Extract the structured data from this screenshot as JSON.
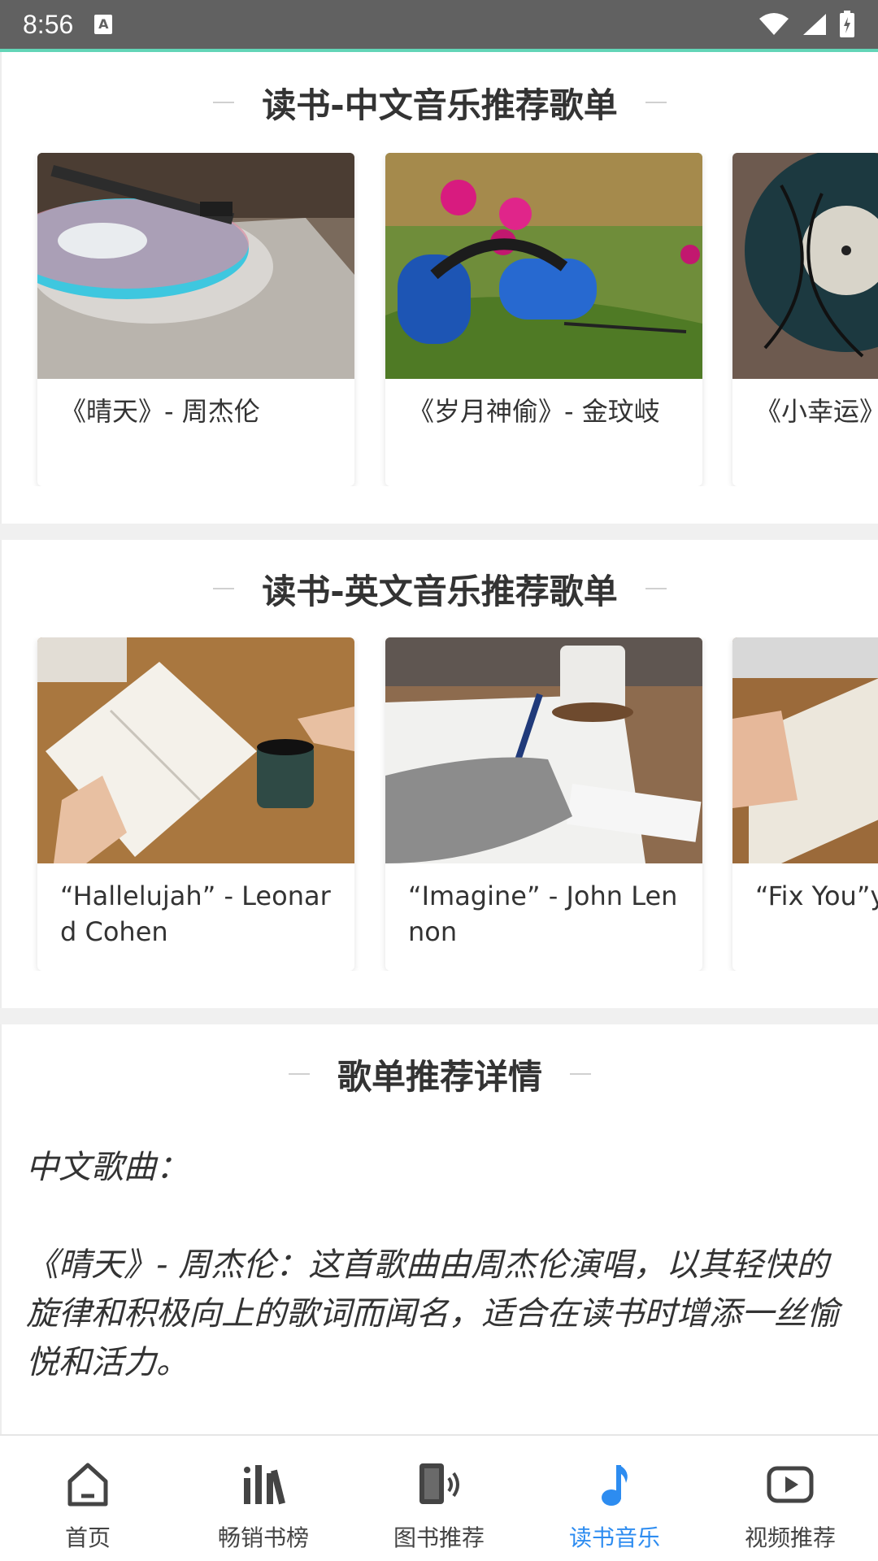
{
  "status_bar": {
    "time": "8:56",
    "notification_icon": "A"
  },
  "section_chinese": {
    "title": "读书-中文音乐推荐歌单",
    "cards": [
      {
        "caption": "《晴天》- 周杰伦",
        "image": "turntable-vinyl-image"
      },
      {
        "caption": "《岁月神偷》- 金玟岐",
        "image": "headphones-flowers-image"
      },
      {
        "caption": "《小幸运》",
        "image": "vinyl-record-earphones-image"
      }
    ]
  },
  "section_english": {
    "title": "读书-英文音乐推荐歌单",
    "cards": [
      {
        "caption": "“Hallelujah” - Leonard Cohen",
        "image": "book-coffee-image"
      },
      {
        "caption": "“Imagine” - John Lennon",
        "image": "writing-desk-image"
      },
      {
        "caption": "“Fix You”y",
        "image": "reading-book-image"
      }
    ]
  },
  "detail": {
    "title": "歌单推荐详情",
    "heading": "中文歌曲：",
    "paragraph": "《晴天》- 周杰伦：这首歌曲由周杰伦演唱，以其轻快的旋律和积极向上的歌词而闻名，适合在读书时增添一丝愉悦和活力。"
  },
  "bottom_nav": [
    {
      "label": "首页",
      "icon": "home-icon",
      "active": false
    },
    {
      "label": "畅销书榜",
      "icon": "books-chart-icon",
      "active": false
    },
    {
      "label": "图书推荐",
      "icon": "book-audio-icon",
      "active": false
    },
    {
      "label": "读书音乐",
      "icon": "music-note-icon",
      "active": true
    },
    {
      "label": "视频推荐",
      "icon": "video-play-icon",
      "active": false
    }
  ],
  "colors": {
    "accent": "#2D8CF0",
    "status_bar": "#616161",
    "status_accent": "#62D5B7",
    "nav_inactive": "#444444"
  }
}
